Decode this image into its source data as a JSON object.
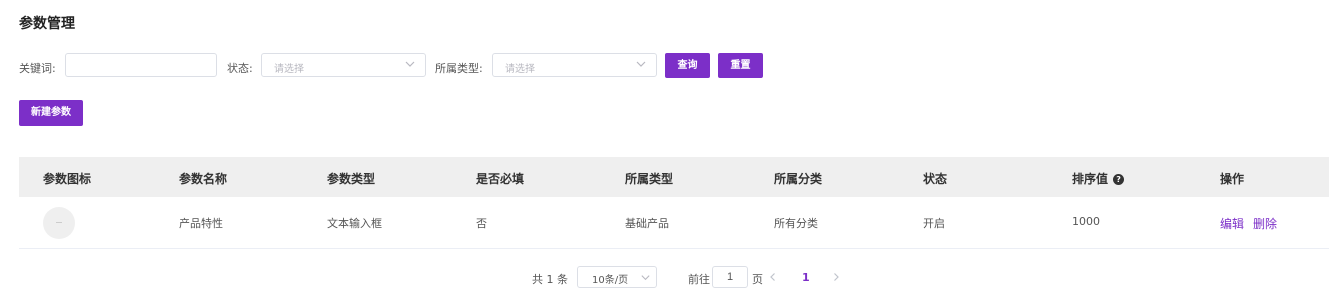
{
  "page": {
    "title": "参数管理"
  },
  "filters": {
    "keyword_label": "关键词:",
    "keyword_value": "",
    "status_label": "状态:",
    "status_placeholder": "请选择",
    "type_label": "所属类型:",
    "type_placeholder": "请选择",
    "search_label": "查询",
    "reset_label": "重置"
  },
  "toolbar": {
    "new_label": "新建参数"
  },
  "table": {
    "headers": [
      "参数图标",
      "参数名称",
      "参数类型",
      "是否必填",
      "所属类型",
      "所属分类",
      "状态",
      "排序值",
      "操作"
    ],
    "sort_help_icon": "question-circle-icon",
    "rows": [
      {
        "name": "产品特性",
        "type": "文本输入框",
        "required": "否",
        "belong_type": "基础产品",
        "category": "所有分类",
        "status": "开启",
        "sort": "1000",
        "actions": {
          "edit": "编辑",
          "delete": "删除"
        }
      }
    ]
  },
  "pagination": {
    "total_text": "共 1 条",
    "page_size": "10条/页",
    "goto_label": "前往",
    "goto_value": "1",
    "page_unit": "页",
    "current_page": "1"
  },
  "colors": {
    "accent": "#7c2fc8",
    "header_bg": "#efefef",
    "border": "#dcdfe6"
  }
}
